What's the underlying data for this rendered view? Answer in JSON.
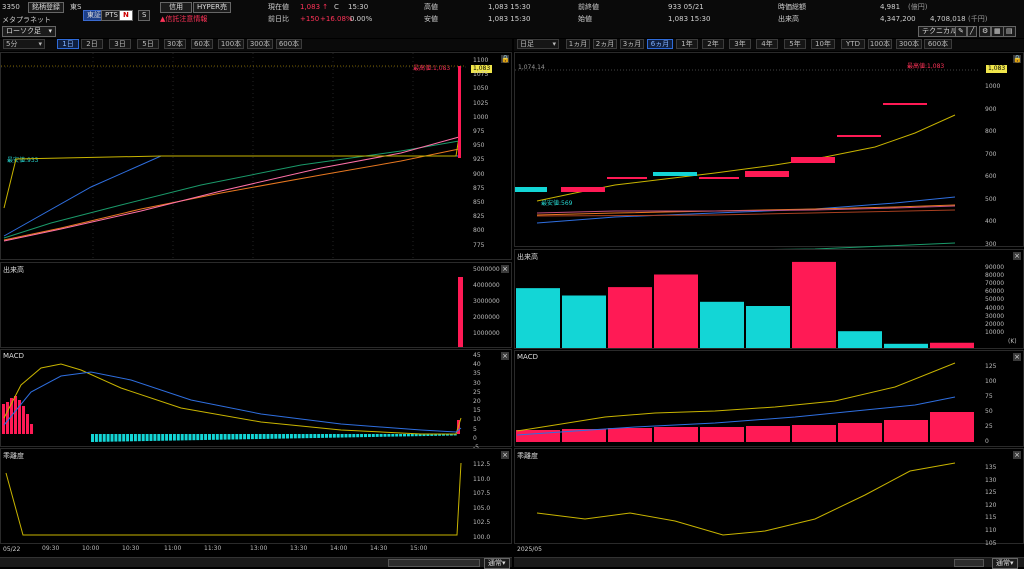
{
  "header": {
    "code": "3350",
    "tab_label": "銘柄登録",
    "market": "東S",
    "mode_labels": [
      "東証",
      "PTS"
    ],
    "n_badge": "N",
    "s_badge": "S",
    "credit": "信用",
    "hyper": "HYPER売",
    "name": "メタプラネット",
    "warning": "信託注意情報",
    "cur_label": "現在値",
    "cur_value": "1,083",
    "cur_arrow": "↑",
    "c_label": "C",
    "cur_time": "15:30",
    "chg_label": "前日比",
    "chg_value": "+150",
    "chg_pct": "+16.08%",
    "zero_pct": "0.00%",
    "high_label": "高値",
    "high_value": "1,083 15:30",
    "low_label": "安値",
    "low_value": "1,083 15:30",
    "prev_label": "前終値",
    "prev_value": "933 05/21",
    "open_label": "始値",
    "open_value": "1,083 15:30",
    "mcap_label": "時価総額",
    "mcap_value": "4,981",
    "mcap_unit": "(億円)",
    "vol_label": "出来高",
    "vol_value": "4,347,200",
    "val_value": "4,708,018",
    "val_unit": "(千円)",
    "tech_btn": "テクニカル"
  },
  "left": {
    "interval": "5分",
    "chart_kind": "ローソク足",
    "ranges": [
      "1日",
      "2日",
      "3日",
      "5日",
      "30本",
      "60本",
      "100本",
      "300本",
      "600本"
    ],
    "active_range": "1日",
    "price_ticks": [
      "1100",
      "1075",
      "1050",
      "1025",
      "1000",
      "975",
      "950",
      "925",
      "900",
      "875",
      "850",
      "825",
      "800",
      "775"
    ],
    "high_annot": "最高値:1,083",
    "low_annot": "最安値:933",
    "price_tag": "1,083",
    "vol_label": "出来高",
    "vol_ticks": [
      "5000000",
      "4000000",
      "3000000",
      "2000000",
      "1000000"
    ],
    "macd_label": "MACD",
    "macd_ticks": [
      "45",
      "40",
      "35",
      "30",
      "25",
      "20",
      "15",
      "10",
      "5",
      "0",
      "-5"
    ],
    "osc_label": "乖離度",
    "osc_ticks": [
      "112.5",
      "110.0",
      "107.5",
      "105.0",
      "102.5",
      "100.0"
    ],
    "date": "05/22",
    "time_ticks": [
      "09:30",
      "10:00",
      "10:30",
      "11:00",
      "11:30",
      "13:00",
      "13:30",
      "14:00",
      "14:30",
      "15:00"
    ],
    "scroll_mode": "通常"
  },
  "right": {
    "interval": "日足",
    "ranges": [
      "1ヵ月",
      "2ヵ月",
      "3ヵ月",
      "6ヵ月",
      "1年",
      "2年",
      "3年",
      "4年",
      "5年",
      "10年",
      "YTD",
      "100本",
      "300本",
      "600本"
    ],
    "active_range": "6ヵ月",
    "price_ticks": [
      "1000",
      "900",
      "800",
      "700",
      "600",
      "500",
      "400",
      "300"
    ],
    "top_price": "1,074.14",
    "high_annot": "最高値:1,083",
    "low_annot": "最安値:569",
    "price_tag": "1,083",
    "vol_label": "出来高",
    "vol_ticks": [
      "90000",
      "80000",
      "70000",
      "60000",
      "50000",
      "40000",
      "30000",
      "20000",
      "10000"
    ],
    "vol_unit": "(K)",
    "macd_label": "MACD",
    "macd_ticks": [
      "125",
      "100",
      "75",
      "50",
      "25",
      "0"
    ],
    "osc_label": "乖離度",
    "osc_ticks": [
      "135",
      "130",
      "125",
      "120",
      "115",
      "110",
      "105"
    ],
    "date": "2025/05",
    "scroll_mode": "通常"
  },
  "colors": {
    "up": "#ff1a55",
    "down": "#13d6d6",
    "ma_short": "#c8b400",
    "ma_mid": "#2f6fe0",
    "ma_pink": "#ff70a8",
    "ma_orange": "#e87820",
    "ma_green": "#1a9a6a"
  }
}
